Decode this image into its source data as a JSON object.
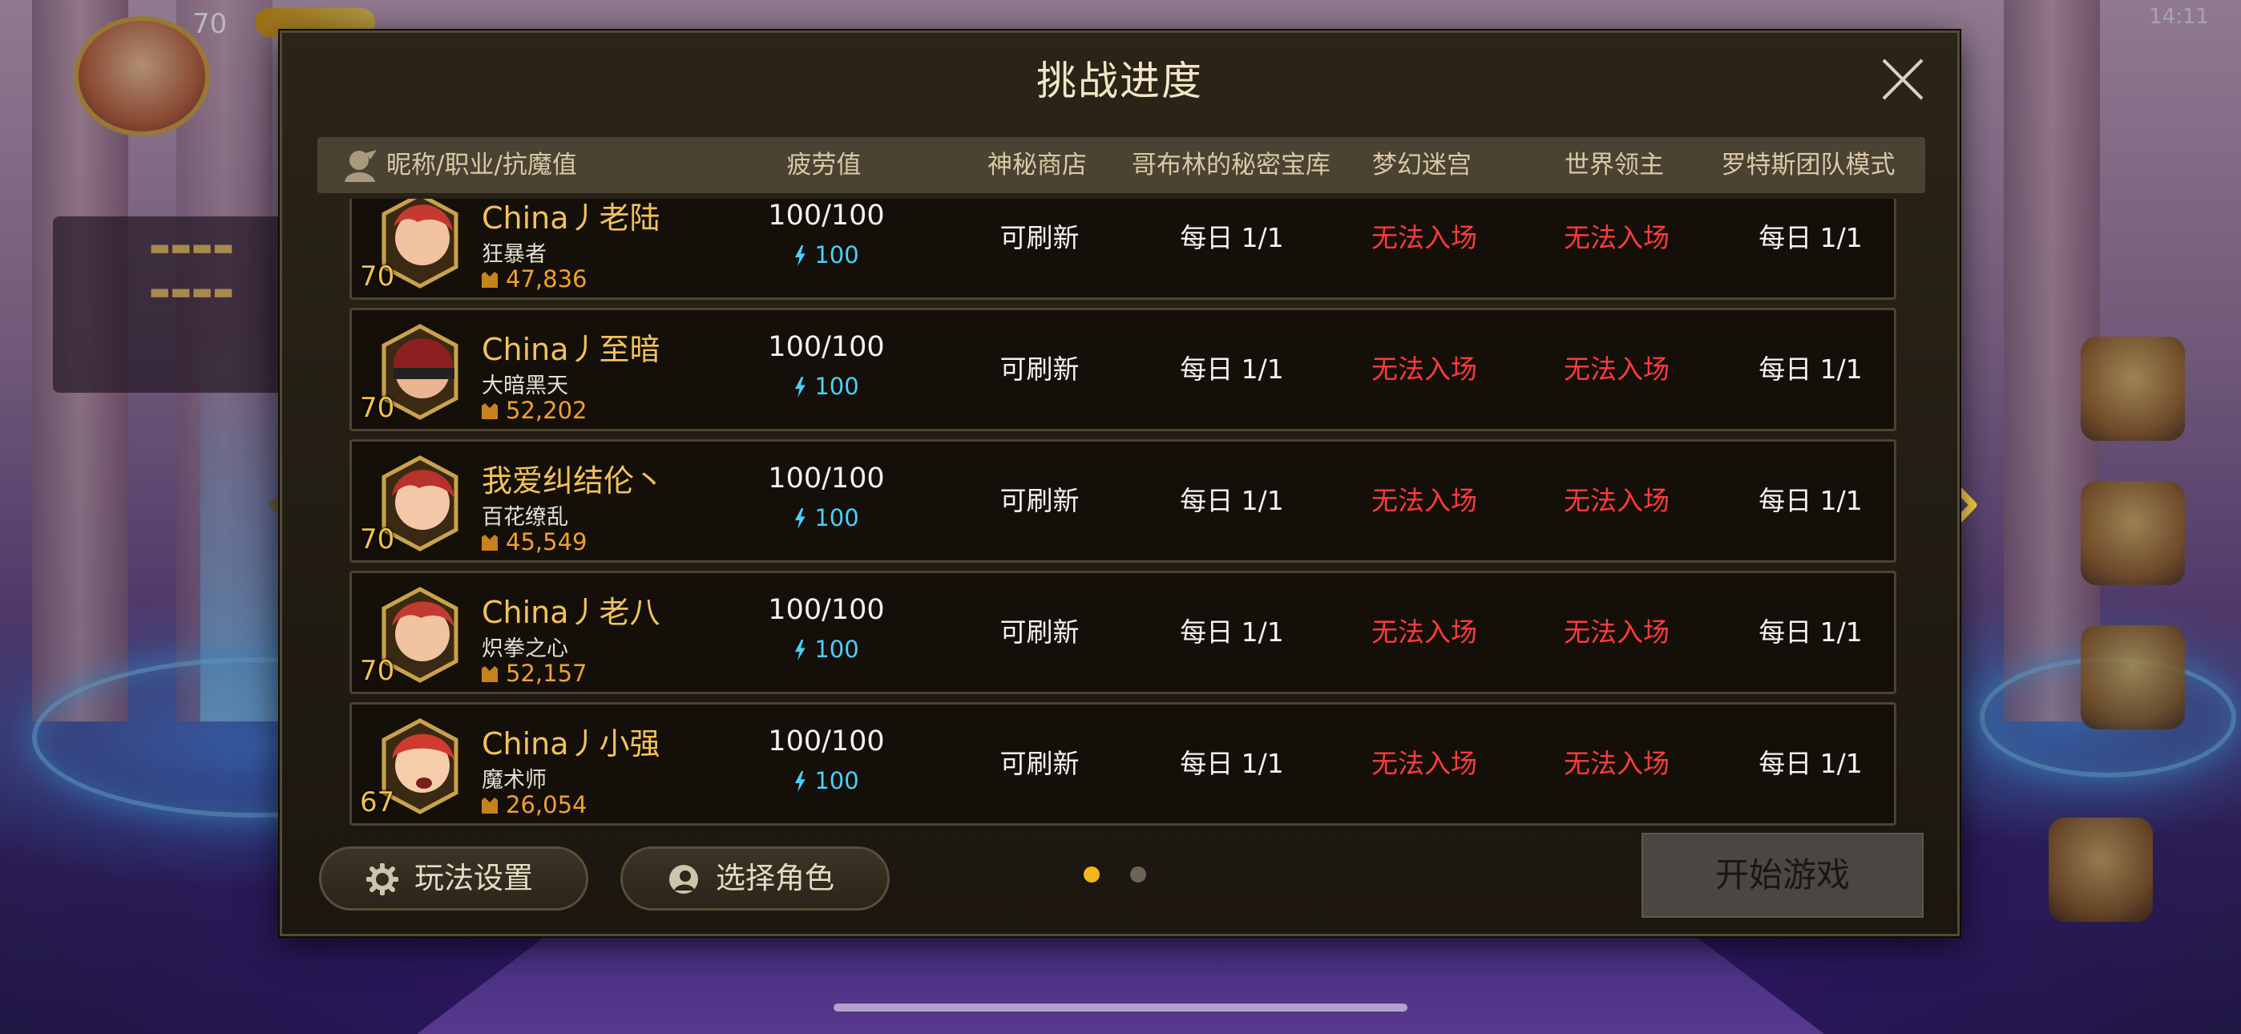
{
  "hud": {
    "level": "70",
    "status_time": "14:11"
  },
  "dialog": {
    "title": "挑战进度"
  },
  "table": {
    "headers": [
      "昵称/职业/抗魔值",
      "疲劳值",
      "神秘商店",
      "哥布林的秘密宝库",
      "梦幻迷宫",
      "世界领主",
      "罗特斯团队模式"
    ],
    "rows": [
      {
        "level": "70",
        "name": "China丿老陆",
        "job": "狂暴者",
        "power": "47,836",
        "fatigue": "100/100",
        "energy": "100",
        "shop": "可刷新",
        "goblin": "每日 1/1",
        "dream": "无法入场",
        "world": "无法入场",
        "lotus": "每日 1/1"
      },
      {
        "level": "70",
        "name": "China丿至暗",
        "job": "大暗黑天",
        "power": "52,202",
        "fatigue": "100/100",
        "energy": "100",
        "shop": "可刷新",
        "goblin": "每日 1/1",
        "dream": "无法入场",
        "world": "无法入场",
        "lotus": "每日 1/1"
      },
      {
        "level": "70",
        "name": "我爱纠结伦丶",
        "job": "百花缭乱",
        "power": "45,549",
        "fatigue": "100/100",
        "energy": "100",
        "shop": "可刷新",
        "goblin": "每日 1/1",
        "dream": "无法入场",
        "world": "无法入场",
        "lotus": "每日 1/1"
      },
      {
        "level": "70",
        "name": "China丿老八",
        "job": "炽拳之心",
        "power": "52,157",
        "fatigue": "100/100",
        "energy": "100",
        "shop": "可刷新",
        "goblin": "每日 1/1",
        "dream": "无法入场",
        "world": "无法入场",
        "lotus": "每日 1/1"
      },
      {
        "level": "67",
        "name": "China丿小强",
        "job": "魔术师",
        "power": "26,054",
        "fatigue": "100/100",
        "energy": "100",
        "shop": "可刷新",
        "goblin": "每日 1/1",
        "dream": "无法入场",
        "world": "无法入场",
        "lotus": "每日 1/1"
      }
    ]
  },
  "buttons": {
    "settings": "玩法设置",
    "select_role": "选择角色",
    "start": "开始游戏"
  },
  "pagination": {
    "current_page": 1,
    "total_pages": 2
  },
  "colors": {
    "name": "#f2c25a",
    "unavailable": "#ff3b3b",
    "energy": "#49d0ff",
    "active_dot": "#f2b81a"
  },
  "icons": {
    "close": "close-icon",
    "header": "character-silhouette-icon",
    "settings": "gear-icon",
    "select_role": "character-switch-icon",
    "left": "chevron-left-icon",
    "right": "chevron-right-icon"
  }
}
